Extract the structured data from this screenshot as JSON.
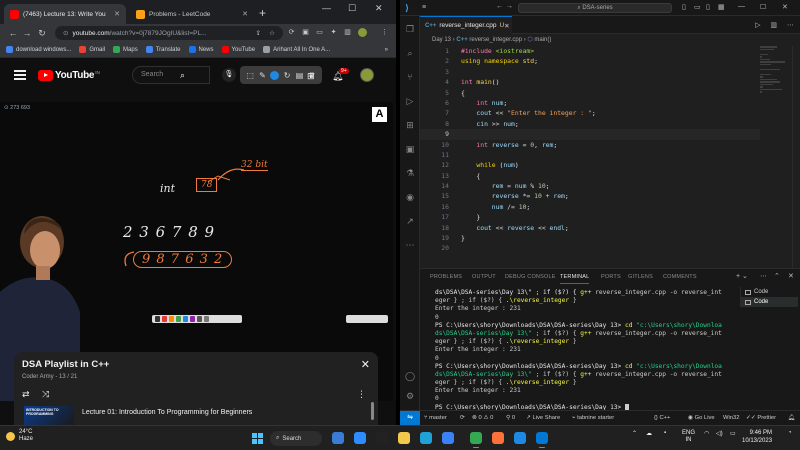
{
  "chrome": {
    "tabs": [
      {
        "label": "(7463) Lecture 13: Write You",
        "active": true,
        "icon_color": "#ff0000"
      },
      {
        "label": "Problems - LeetCode",
        "active": false,
        "icon_color": "#ffa116"
      }
    ],
    "new_tab": "+",
    "window_controls": [
      "—",
      "☐",
      "✕"
    ],
    "url_host": "youtube.com",
    "url_rest": "/watch?v=0j7879JOgIU&list=PL...",
    "bookmarks": [
      {
        "label": "download windows...",
        "icon_color": "#4285f4"
      },
      {
        "label": "Gmail",
        "icon_color": "#ea4335"
      },
      {
        "label": "Maps",
        "icon_color": "#34a853"
      },
      {
        "label": "Translate",
        "icon_color": "#4285f4"
      },
      {
        "label": "News",
        "icon_color": "#1a73e8"
      },
      {
        "label": "YouTube",
        "icon_color": "#ff0000"
      },
      {
        "label": "Arihant All In One A...",
        "icon_color": "#9aa0a6"
      }
    ],
    "bookmarks_more": "»"
  },
  "youtube": {
    "logo_text": "YouTube",
    "country": "IN",
    "search_placeholder": "Search",
    "notif_count": "9+",
    "video": {
      "viewers": "273 693",
      "brand": "A",
      "chalk": {
        "int_label": "int",
        "box_value": "78",
        "bits": "32 bit",
        "number": "2 3 6 7 8 9",
        "reversed": "9 8 7 6 3 2"
      }
    },
    "playlist": {
      "title": "DSA Playlist in C++",
      "subtitle": "Coder Army - 13 / 21",
      "item_thumb": "INTRODUCTION TO PROGRAMMING",
      "item_title": "Lecture 01: Introduction To Programming for Beginners"
    }
  },
  "vscode": {
    "menu_icon": "≡",
    "search_text": "DSA-series",
    "tab": {
      "lang": "C++",
      "file": "reverse_integer.cpp",
      "modified": "U"
    },
    "breadcrumbs": {
      "folder": "Day 13",
      "lang": "C++",
      "file": "reverse_integer.cpp",
      "symbol": "main()"
    },
    "code_lines": [
      {
        "n": "1",
        "tokens": [
          [
            "pp",
            "#include "
          ],
          [
            "inc",
            "<iostream>"
          ]
        ]
      },
      {
        "n": "2",
        "tokens": [
          [
            "kw",
            "using "
          ],
          [
            "kw",
            "namespace "
          ],
          [
            "std",
            "std"
          ],
          [
            "pu",
            ";"
          ]
        ]
      },
      {
        "n": "3",
        "tokens": []
      },
      {
        "n": "4",
        "tokens": [
          [
            "ty",
            "int "
          ],
          [
            "fn",
            "main"
          ],
          [
            "pu",
            "()"
          ]
        ]
      },
      {
        "n": "5",
        "tokens": [
          [
            "pu",
            "{"
          ]
        ]
      },
      {
        "n": "6",
        "tokens": [
          [
            "pu",
            "    "
          ],
          [
            "ty",
            "int "
          ],
          [
            "id",
            "num"
          ],
          [
            "pu",
            ";"
          ]
        ]
      },
      {
        "n": "7",
        "tokens": [
          [
            "pu",
            "    "
          ],
          [
            "id",
            "cout "
          ],
          [
            "op",
            "<< "
          ],
          [
            "str",
            "\"Enter the integer : \""
          ],
          [
            "pu",
            ";"
          ]
        ]
      },
      {
        "n": "8",
        "tokens": [
          [
            "pu",
            "    "
          ],
          [
            "id",
            "cin "
          ],
          [
            "op",
            ">> "
          ],
          [
            "id",
            "num"
          ],
          [
            "pu",
            ";"
          ]
        ]
      },
      {
        "n": "9",
        "tokens": [],
        "current": true
      },
      {
        "n": "10",
        "tokens": [
          [
            "pu",
            "    "
          ],
          [
            "ty",
            "int "
          ],
          [
            "id",
            "reverse "
          ],
          [
            "op",
            "= "
          ],
          [
            "num",
            "0"
          ],
          [
            "pu",
            ", "
          ],
          [
            "id",
            "rem"
          ],
          [
            "pu",
            ";"
          ]
        ]
      },
      {
        "n": "11",
        "tokens": []
      },
      {
        "n": "12",
        "tokens": [
          [
            "pu",
            "    "
          ],
          [
            "kw",
            "while "
          ],
          [
            "pu",
            "("
          ],
          [
            "id",
            "num"
          ],
          [
            "pu",
            ")"
          ]
        ]
      },
      {
        "n": "13",
        "tokens": [
          [
            "pu",
            "    {"
          ]
        ]
      },
      {
        "n": "14",
        "tokens": [
          [
            "pu",
            "        "
          ],
          [
            "id",
            "rem "
          ],
          [
            "op",
            "= "
          ],
          [
            "id",
            "num "
          ],
          [
            "op",
            "% "
          ],
          [
            "num",
            "10"
          ],
          [
            "pu",
            ";"
          ]
        ]
      },
      {
        "n": "15",
        "tokens": [
          [
            "pu",
            "        "
          ],
          [
            "id",
            "reverse "
          ],
          [
            "op",
            "*= "
          ],
          [
            "num",
            "10 "
          ],
          [
            "op",
            "+ "
          ],
          [
            "id",
            "rem"
          ],
          [
            "pu",
            ";"
          ]
        ]
      },
      {
        "n": "16",
        "tokens": [
          [
            "pu",
            "        "
          ],
          [
            "id",
            "num "
          ],
          [
            "op",
            "/= "
          ],
          [
            "num",
            "10"
          ],
          [
            "pu",
            ";"
          ]
        ]
      },
      {
        "n": "17",
        "tokens": [
          [
            "pu",
            "    }"
          ]
        ]
      },
      {
        "n": "18",
        "tokens": [
          [
            "pu",
            "    "
          ],
          [
            "id",
            "cout "
          ],
          [
            "op",
            "<< "
          ],
          [
            "id",
            "reverse "
          ],
          [
            "op",
            "<< "
          ],
          [
            "id",
            "endl"
          ],
          [
            "pu",
            ";"
          ]
        ]
      },
      {
        "n": "19",
        "tokens": [
          [
            "pu",
            "}"
          ]
        ]
      },
      {
        "n": "20",
        "tokens": []
      }
    ],
    "panel_tabs": [
      "PROBLEMS",
      "OUTPUT",
      "DEBUG CONSOLE",
      "TERMINAL",
      "PORTS",
      "GITLENS",
      "COMMENTS"
    ],
    "active_panel_tab": "TERMINAL",
    "terminal_lines": [
      [
        [
          "path",
          "ds\\DSA\\DSA-series\\Day 13\\\" ; if ($?) { "
        ],
        [
          "cmd",
          "g++ "
        ],
        [
          "op",
          "reverse_integer.cpp -o reverse_int"
        ]
      ],
      [
        [
          "op",
          "eger } ; if ($?) { "
        ],
        [
          "cmd",
          ".\\reverse_integer"
        ],
        [
          "op",
          " }"
        ]
      ],
      [
        [
          "op",
          "Enter the integer : 231"
        ]
      ],
      [
        [
          "op",
          "0"
        ]
      ],
      [
        [
          "path",
          "PS C:\\Users\\shory\\Downloads\\DSA\\DSA-series\\Day 13> "
        ],
        [
          "cmd",
          "cd "
        ],
        [
          "str",
          "\"c:\\Users\\shory\\Downloa"
        ]
      ],
      [
        [
          "str",
          "ds\\DSA\\DSA-series\\Day 13\\\""
        ],
        [
          "op",
          " ; if ($?) { "
        ],
        [
          "cmd",
          "g++ "
        ],
        [
          "op",
          "reverse_integer.cpp -o reverse_int"
        ]
      ],
      [
        [
          "op",
          "eger } ; if ($?) { "
        ],
        [
          "cmd",
          ".\\reverse_integer"
        ],
        [
          "op",
          " }"
        ]
      ],
      [
        [
          "op",
          "Enter the integer : 231"
        ]
      ],
      [
        [
          "op",
          "0"
        ]
      ],
      [
        [
          "path",
          "PS C:\\Users\\shory\\Downloads\\DSA\\DSA-series\\Day 13> "
        ],
        [
          "cmd",
          "cd "
        ],
        [
          "str",
          "\"c:\\Users\\shory\\Downloa"
        ]
      ],
      [
        [
          "str",
          "ds\\DSA\\DSA-series\\Day 13\\\""
        ],
        [
          "op",
          " ; if ($?) { "
        ],
        [
          "cmd",
          "g++ "
        ],
        [
          "op",
          "reverse_integer.cpp -o reverse_int"
        ]
      ],
      [
        [
          "op",
          "eger } ; if ($?) { "
        ],
        [
          "cmd",
          ".\\reverse_integer"
        ],
        [
          "op",
          " }"
        ]
      ],
      [
        [
          "op",
          "Enter the integer : 231"
        ]
      ],
      [
        [
          "op",
          "0"
        ]
      ],
      [
        [
          "path",
          "PS C:\\Users\\shory\\Downloads\\DSA\\DSA-series\\Day 13> "
        ]
      ]
    ],
    "terminal_list": [
      {
        "label": "Code",
        "selected": false
      },
      {
        "label": "Code",
        "selected": true
      }
    ],
    "status": {
      "branch": "master",
      "sync": "⟳",
      "errors": "0",
      "warnings": "0",
      "ports": "0",
      "live_share": "Live Share",
      "tabnine": "tabnine starter",
      "lang": "C++",
      "go_live": "Go Live",
      "platform": "Win32",
      "prettier": "Prettier"
    }
  },
  "taskbar": {
    "temp": "24°C",
    "weather": "Haze",
    "search_label": "Search",
    "lang": "ENG",
    "region": "IN",
    "time": "9:46 PM",
    "date": "10/13/2023",
    "apps": [
      {
        "name": "widgets",
        "color": "#3a7bd5",
        "open": false
      },
      {
        "name": "zoom",
        "color": "#2d8cff",
        "open": false
      },
      {
        "name": "media-player",
        "color": "#222",
        "open": false
      },
      {
        "name": "file-explorer",
        "color": "#f2c94c",
        "open": false
      },
      {
        "name": "edge",
        "color": "#1fa3d6",
        "open": false
      },
      {
        "name": "store",
        "color": "#3b82f6",
        "open": false
      },
      {
        "name": "firefox",
        "color": "#ff7139",
        "open": false
      },
      {
        "name": "chrome",
        "color": "#34a853",
        "open": true
      },
      {
        "name": "app-blue",
        "color": "#1e88e5",
        "open": false
      },
      {
        "name": "vscode",
        "color": "#0078d4",
        "open": true
      }
    ]
  }
}
